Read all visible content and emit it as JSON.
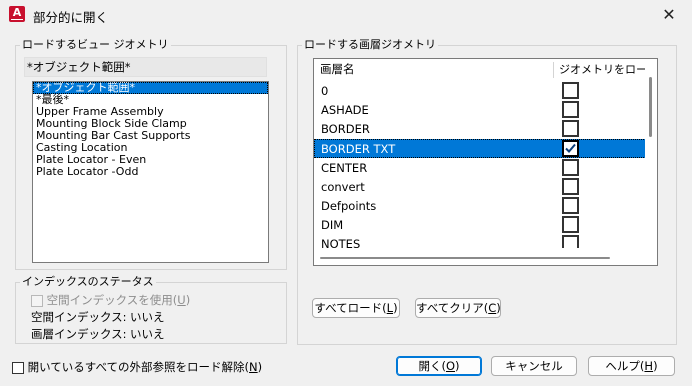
{
  "window": {
    "title": "部分的に開く",
    "close_glyph": "✕",
    "app_icon_letter": "A"
  },
  "view_geometry": {
    "group_label": "ロードするビュー ジオメトリ",
    "header_value": "*オブジェクト範囲*",
    "items": [
      {
        "label": "*オブジェクト範囲*",
        "selected": true
      },
      {
        "label": "*最後*",
        "selected": false
      },
      {
        "label": "Upper Frame Assembly",
        "selected": false
      },
      {
        "label": "Mounting Block Side Clamp",
        "selected": false
      },
      {
        "label": "Mounting Bar Cast Supports",
        "selected": false
      },
      {
        "label": "Casting Location",
        "selected": false
      },
      {
        "label": "Plate Locator - Even",
        "selected": false
      },
      {
        "label": "Plate Locator -Odd",
        "selected": false
      }
    ]
  },
  "index_status": {
    "group_label": "インデックスのステータス",
    "use_spatial_index_label": "空間インデックスを使用(",
    "use_spatial_index_key": "U",
    "spatial_index_label": "空間インデックス:",
    "spatial_index_value": "いいえ",
    "layer_index_label": "画層インデックス:",
    "layer_index_value": "いいえ"
  },
  "layer_geometry": {
    "group_label": "ロードする画層ジオメトリ",
    "col_name": "画層名",
    "col_load": "ジオメトリをロード",
    "rows": [
      {
        "name": "0",
        "checked": false,
        "selected": false
      },
      {
        "name": "ASHADE",
        "checked": false,
        "selected": false
      },
      {
        "name": "BORDER",
        "checked": false,
        "selected": false
      },
      {
        "name": "BORDER TXT",
        "checked": true,
        "selected": true
      },
      {
        "name": "CENTER",
        "checked": false,
        "selected": false
      },
      {
        "name": "convert",
        "checked": false,
        "selected": false
      },
      {
        "name": "Defpoints",
        "checked": false,
        "selected": false
      },
      {
        "name": "DIM",
        "checked": false,
        "selected": false
      },
      {
        "name": "NOTES",
        "checked": false,
        "selected": false
      }
    ],
    "load_all": {
      "label": "すべてロード(",
      "key": "L"
    },
    "clear_all": {
      "label": "すべてクリア(",
      "key": "C"
    }
  },
  "unload_xrefs": {
    "label": "開いているすべての外部参照をロード解除(",
    "key": "N",
    "checked": false
  },
  "buttons": {
    "open": {
      "label": "開く(",
      "key": "O"
    },
    "cancel": {
      "label": "キャンセル"
    },
    "help": {
      "label": "ヘルプ(",
      "key": "H"
    }
  },
  "colors": {
    "selection": "#0078d7",
    "app_icon": "#c8102e"
  },
  "icons": {
    "check": "check-icon",
    "close": "close-icon"
  }
}
